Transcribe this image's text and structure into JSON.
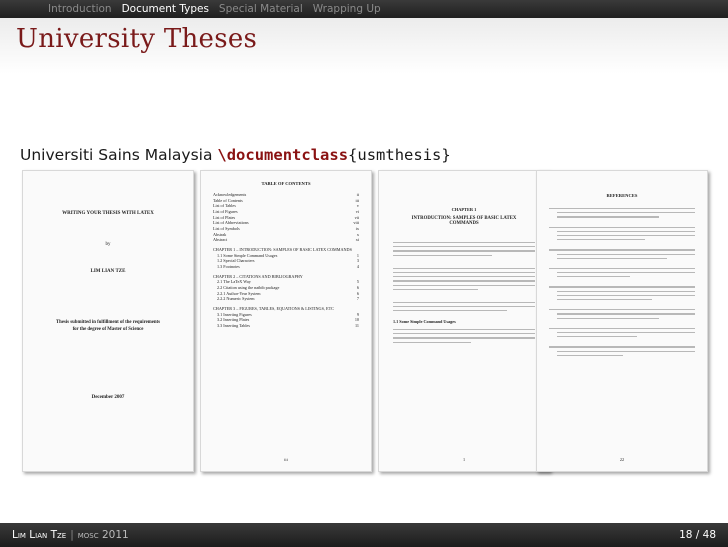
{
  "nav": {
    "items": [
      {
        "label": "Introduction"
      },
      {
        "label": "Document Types",
        "active": true
      },
      {
        "label": "Special Material"
      },
      {
        "label": "Wrapping Up"
      }
    ]
  },
  "frame": {
    "title": "University Theses",
    "subtitle_text": "Universiti Sains Malaysia",
    "subtitle_command": "\\documentclass",
    "subtitle_arg": "{usmthesis}"
  },
  "pages": {
    "title_page": {
      "heading": "WRITING YOUR THESIS WITH LATEX",
      "by": "by",
      "author": "LIM LIAN TZE",
      "submitted": "Thesis submitted in fulfillment of the requirements for the degree of Master of Science",
      "date": "December 2007"
    },
    "toc": {
      "heading": "TABLE OF CONTENTS",
      "front": [
        {
          "label": "Acknowledgements",
          "page": "ii"
        },
        {
          "label": "Table of Contents",
          "page": "iii"
        },
        {
          "label": "List of Tables",
          "page": "v"
        },
        {
          "label": "List of Figures",
          "page": "vi"
        },
        {
          "label": "List of Plates",
          "page": "vii"
        },
        {
          "label": "List of Abbreviations",
          "page": "viii"
        },
        {
          "label": "List of Symbols",
          "page": "ix"
        },
        {
          "label": "Abstrak",
          "page": "x"
        },
        {
          "label": "Abstract",
          "page": "xi"
        }
      ],
      "chapters": [
        {
          "title": "CHAPTER 1 – INTRODUCTION: SAMPLES OF BASIC LATEX COMMANDS",
          "sections": [
            {
              "label": "1.1 Some Simple Command Usages",
              "page": "1"
            },
            {
              "label": "1.2 Special Characters",
              "page": "3"
            },
            {
              "label": "1.3 Footnotes",
              "page": "4"
            }
          ]
        },
        {
          "title": "CHAPTER 2 – CITATIONS AND BIBLIOGRAPHY",
          "sections": [
            {
              "label": "2.1 The LaTeX Way",
              "page": "5"
            },
            {
              "label": "2.2 Citation using the natbib package",
              "page": "6"
            },
            {
              "label": "2.2.1 Author-Year System",
              "page": "6"
            },
            {
              "label": "2.2.2 Numeric System",
              "page": "7"
            }
          ]
        },
        {
          "title": "CHAPTER 3 – FIGURES, TABLES, EQUATIONS & LISTINGS, ETC",
          "sections": [
            {
              "label": "3.1 Inserting Figures",
              "page": "9"
            },
            {
              "label": "3.2 Inserting Plates",
              "page": "10"
            },
            {
              "label": "3.3 Inserting Tables",
              "page": "11"
            }
          ]
        }
      ],
      "folio": "iii"
    },
    "chapter": {
      "label": "CHAPTER 1",
      "title": "INTRODUCTION: SAMPLES OF BASIC LATEX COMMANDS",
      "section_title": "1.1 Some Simple Command Usages",
      "folio": "1"
    },
    "references": {
      "heading": "REFERENCES",
      "folio": "22"
    }
  },
  "footer": {
    "author": "Lim Lian Tze",
    "event": "mosc 2011",
    "pages": "18 / 48"
  }
}
